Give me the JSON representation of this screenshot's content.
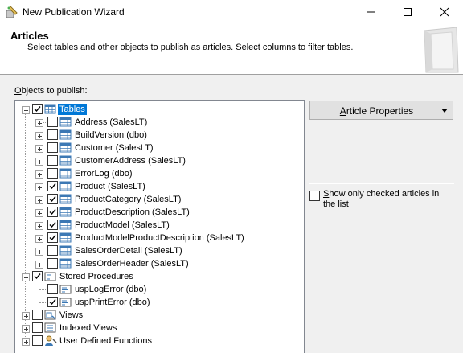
{
  "window": {
    "title": "New Publication Wizard"
  },
  "header": {
    "title": "Articles",
    "subtitle": "Select tables and other objects to publish as articles. Select columns to filter tables."
  },
  "objects_label_key": "O",
  "objects_label_rest": "bjects to publish:",
  "tree": {
    "tables_label": "Tables",
    "tables": [
      {
        "label": "Address (SalesLT)",
        "checked": false
      },
      {
        "label": "BuildVersion (dbo)",
        "checked": false
      },
      {
        "label": "Customer (SalesLT)",
        "checked": false
      },
      {
        "label": "CustomerAddress (SalesLT)",
        "checked": false
      },
      {
        "label": "ErrorLog (dbo)",
        "checked": false
      },
      {
        "label": "Product (SalesLT)",
        "checked": true
      },
      {
        "label": "ProductCategory (SalesLT)",
        "checked": true
      },
      {
        "label": "ProductDescription (SalesLT)",
        "checked": true
      },
      {
        "label": "ProductModel (SalesLT)",
        "checked": true
      },
      {
        "label": "ProductModelProductDescription (SalesLT)",
        "checked": true
      },
      {
        "label": "SalesOrderDetail (SalesLT)",
        "checked": false
      },
      {
        "label": "SalesOrderHeader (SalesLT)",
        "checked": false
      }
    ],
    "procs_label": "Stored Procedures",
    "procs": [
      {
        "label": "uspLogError (dbo)",
        "checked": false
      },
      {
        "label": "uspPrintError (dbo)",
        "checked": true
      }
    ],
    "views_label": "Views",
    "indexed_views_label": "Indexed Views",
    "udf_label": "User Defined Functions"
  },
  "article_properties": {
    "key": "A",
    "rest": "rticle Properties"
  },
  "show_checked": {
    "key": "S",
    "rest": "how only checked articles in the list",
    "checked": false
  },
  "colors": {
    "selection": "#0078d7",
    "table_icon": "#3c78b4"
  }
}
